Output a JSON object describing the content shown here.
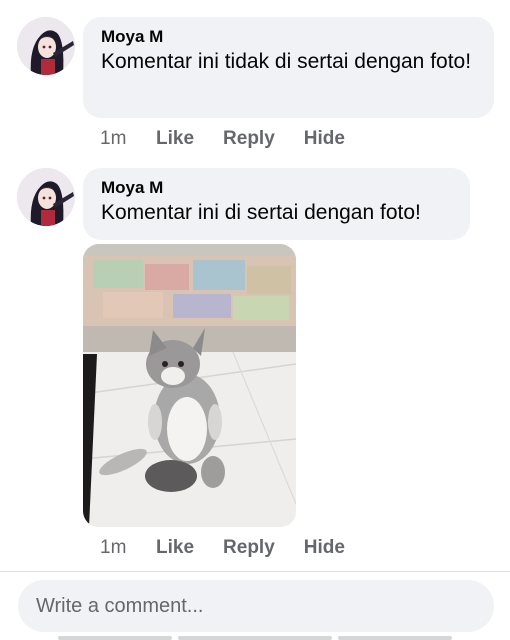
{
  "comments": [
    {
      "author": "Moya M",
      "text": "Komentar ini tidak di sertai dengan foto!",
      "time": "1m",
      "like_label": "Like",
      "reply_label": "Reply",
      "hide_label": "Hide"
    },
    {
      "author": "Moya M",
      "text": "Komentar ini di sertai dengan foto!",
      "time": "1m",
      "like_label": "Like",
      "reply_label": "Reply",
      "hide_label": "Hide",
      "photo": "cat-photo"
    }
  ],
  "composer": {
    "placeholder": "Write a comment..."
  },
  "colors": {
    "bubble_bg": "#f0f2f5",
    "meta_text": "#65676b",
    "primary_text": "#050505"
  }
}
